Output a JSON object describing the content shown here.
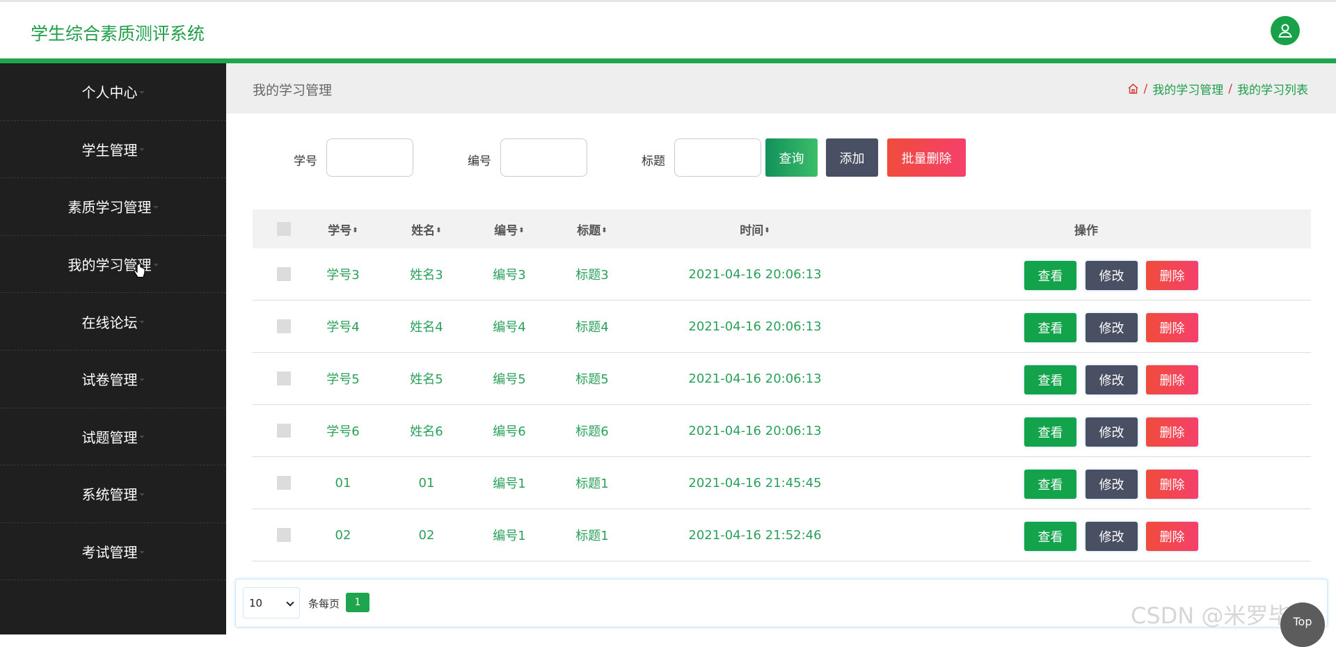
{
  "header": {
    "title": "学生综合素质测评系统",
    "avatar_icon": "user-icon"
  },
  "sidebar": {
    "items": [
      {
        "label": "个人中心"
      },
      {
        "label": "学生管理"
      },
      {
        "label": "素质学习管理"
      },
      {
        "label": "我的学习管理"
      },
      {
        "label": "在线论坛"
      },
      {
        "label": "试卷管理"
      },
      {
        "label": "试题管理"
      },
      {
        "label": "系统管理"
      },
      {
        "label": "考试管理"
      }
    ]
  },
  "page": {
    "title": "我的学习管理",
    "breadcrumb": [
      "我的学习管理",
      "我的学习列表"
    ],
    "separator": "/"
  },
  "search": {
    "fields": [
      {
        "label": "学号",
        "value": ""
      },
      {
        "label": "编号",
        "value": ""
      },
      {
        "label": "标题",
        "value": ""
      }
    ],
    "query_label": "查询",
    "add_label": "添加",
    "batch_delete_label": "批量删除"
  },
  "table": {
    "headers": [
      "学号",
      "姓名",
      "编号",
      "标题",
      "时间",
      "操作"
    ],
    "sort_icon": "⬍",
    "rows": [
      [
        "学号3",
        "姓名3",
        "编号3",
        "标题3",
        "2021-04-16 20:06:13"
      ],
      [
        "学号4",
        "姓名4",
        "编号4",
        "标题4",
        "2021-04-16 20:06:13"
      ],
      [
        "学号5",
        "姓名5",
        "编号5",
        "标题5",
        "2021-04-16 20:06:13"
      ],
      [
        "学号6",
        "姓名6",
        "编号6",
        "标题6",
        "2021-04-16 20:06:13"
      ],
      [
        "01",
        "01",
        "编号1",
        "标题1",
        "2021-04-16 21:45:45"
      ],
      [
        "02",
        "02",
        "编号1",
        "标题1",
        "2021-04-16 21:52:46"
      ]
    ],
    "actions": {
      "view": "查看",
      "edit": "修改",
      "delete": "删除"
    }
  },
  "pagination": {
    "page_size": "10",
    "page_size_label": "条每页",
    "current_page": "1"
  },
  "colors": {
    "brand_green": "#1ea54d",
    "sidebar_bg": "#1f1f1f",
    "danger": "#f04c3c",
    "slate": "#4a5063"
  },
  "watermark": "CSDN @米罗毕设",
  "back_to_top": "Top"
}
